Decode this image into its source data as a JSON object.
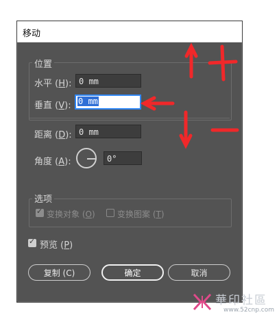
{
  "dialog": {
    "title": "移动",
    "position_group": {
      "legend": "位置",
      "horizontal": {
        "label": "水平 (",
        "key": "H",
        "end": "):",
        "value": "0 mm"
      },
      "vertical": {
        "label": "垂直 (",
        "key": "V",
        "end": "):",
        "value": "0 mm"
      }
    },
    "distance": {
      "label": "距离 (",
      "key": "D",
      "end": "):",
      "value": "0 mm"
    },
    "angle": {
      "label": "角度 (",
      "key": "A",
      "end": "):",
      "value": "0°"
    },
    "options_group": {
      "legend": "选项",
      "transform_objects": {
        "label": "变换对象 (",
        "key": "O",
        "end": ")",
        "checked": true
      },
      "transform_patterns": {
        "label": "变换图案 (",
        "key": "T",
        "end": ")",
        "checked": false
      }
    },
    "preview": {
      "label": "预览 (",
      "key": "P",
      "end": ")",
      "checked": true
    },
    "buttons": {
      "copy": "复制 (C)",
      "ok": "确定",
      "cancel": "取消"
    }
  },
  "annotations": {
    "plus": "+",
    "minus": "−"
  },
  "watermark": {
    "brand": "華印社區",
    "url": "www.52cnp.com"
  },
  "colors": {
    "dialog_bg": "#535353",
    "annotation_red": "#f0282a",
    "selection_blue": "#2f6fd6"
  }
}
